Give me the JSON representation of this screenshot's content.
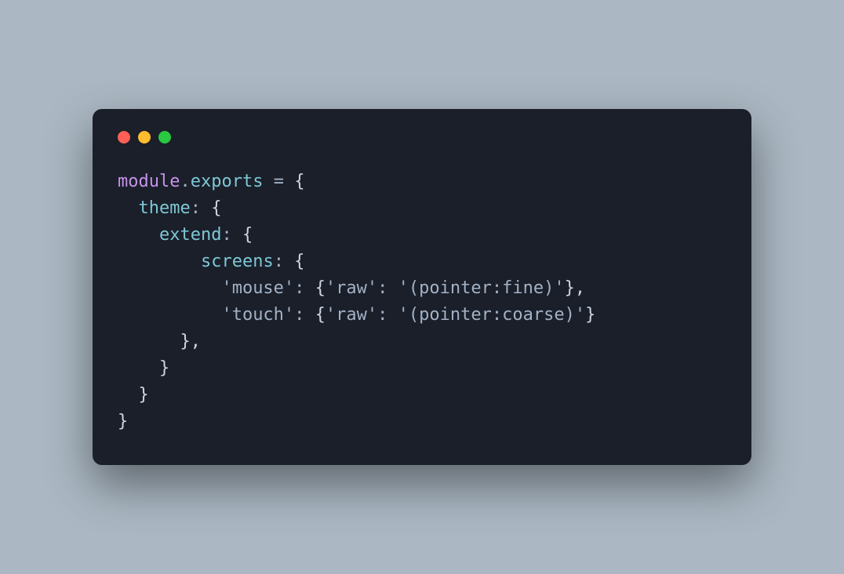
{
  "window": {
    "traffic_lights": [
      "red",
      "yellow",
      "green"
    ]
  },
  "code": {
    "tokens": [
      {
        "t": "module",
        "c": "kw-module"
      },
      {
        "t": ".",
        "c": "op"
      },
      {
        "t": "exports",
        "c": "kw-exports"
      },
      {
        "t": " ",
        "c": "punct"
      },
      {
        "t": "=",
        "c": "op"
      },
      {
        "t": " {",
        "c": "punct"
      },
      {
        "t": "\n  ",
        "c": "punct"
      },
      {
        "t": "theme",
        "c": "prop"
      },
      {
        "t": ":",
        "c": "op"
      },
      {
        "t": " {",
        "c": "punct"
      },
      {
        "t": "\n    ",
        "c": "punct"
      },
      {
        "t": "extend",
        "c": "prop"
      },
      {
        "t": ":",
        "c": "op"
      },
      {
        "t": " {",
        "c": "punct"
      },
      {
        "t": "\n        ",
        "c": "punct"
      },
      {
        "t": "screens",
        "c": "prop"
      },
      {
        "t": ":",
        "c": "op"
      },
      {
        "t": " {",
        "c": "punct"
      },
      {
        "t": "\n          ",
        "c": "punct"
      },
      {
        "t": "'mouse'",
        "c": "str"
      },
      {
        "t": ":",
        "c": "op"
      },
      {
        "t": " {",
        "c": "punct"
      },
      {
        "t": "'raw'",
        "c": "str"
      },
      {
        "t": ":",
        "c": "op"
      },
      {
        "t": " ",
        "c": "punct"
      },
      {
        "t": "'(pointer:fine)'",
        "c": "str"
      },
      {
        "t": "},",
        "c": "punct"
      },
      {
        "t": "\n          ",
        "c": "punct"
      },
      {
        "t": "'touch'",
        "c": "str"
      },
      {
        "t": ":",
        "c": "op"
      },
      {
        "t": " {",
        "c": "punct"
      },
      {
        "t": "'raw'",
        "c": "str"
      },
      {
        "t": ":",
        "c": "op"
      },
      {
        "t": " ",
        "c": "punct"
      },
      {
        "t": "'(pointer:coarse)'",
        "c": "str"
      },
      {
        "t": "}",
        "c": "punct"
      },
      {
        "t": "\n      },",
        "c": "punct"
      },
      {
        "t": "\n    }",
        "c": "punct"
      },
      {
        "t": "\n  }",
        "c": "punct"
      },
      {
        "t": "\n}",
        "c": "punct"
      }
    ]
  }
}
